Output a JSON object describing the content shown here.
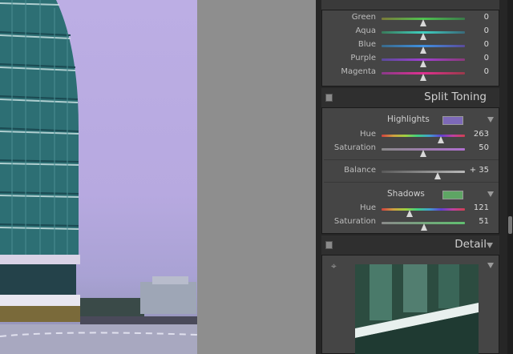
{
  "hsl_tail": [
    {
      "label": "Green",
      "value": "0",
      "thumb": 0.5,
      "gradient": "linear-gradient(90deg,#7a7a3a,#4fc24f,#3a7a4a)"
    },
    {
      "label": "Aqua",
      "value": "0",
      "thumb": 0.5,
      "gradient": "linear-gradient(90deg,#3a7a5a,#3fd0c0,#3a6a7a)"
    },
    {
      "label": "Blue",
      "value": "0",
      "thumb": 0.5,
      "gradient": "linear-gradient(90deg,#3a6a8a,#3f90e0,#5a4a9a)"
    },
    {
      "label": "Purple",
      "value": "0",
      "thumb": 0.5,
      "gradient": "linear-gradient(90deg,#5a4a9a,#a040d0,#8a3a7a)"
    },
    {
      "label": "Magenta",
      "value": "0",
      "thumb": 0.5,
      "gradient": "linear-gradient(90deg,#8a3a8a,#e03090,#9a3a4a)"
    }
  ],
  "split_toning": {
    "title": "Split Toning",
    "highlights": {
      "label": "Highlights",
      "swatch": "#7d69b8",
      "hue": {
        "label": "Hue",
        "value": "263",
        "thumb": 0.71
      },
      "saturation": {
        "label": "Saturation",
        "value": "50",
        "thumb": 0.5
      }
    },
    "balance": {
      "label": "Balance",
      "value": "+ 35",
      "thumb": 0.67
    },
    "shadows": {
      "label": "Shadows",
      "swatch": "#5ea564",
      "hue": {
        "label": "Hue",
        "value": "121",
        "thumb": 0.34
      },
      "saturation": {
        "label": "Saturation",
        "value": "51",
        "thumb": 0.51
      }
    }
  },
  "detail": {
    "title": "Detail"
  },
  "colors": {
    "hue_gradient": "linear-gradient(90deg,#d04040,#d0a040,#a0d040,#40d080,#40a0d0,#6040d0,#c040a0,#d04050)",
    "sat_gradient_high": "linear-gradient(90deg,#8a8a8a,#b070d0)",
    "sat_gradient_shadow": "linear-gradient(90deg,#8a8a8a,#60c070)",
    "balance_gradient": "linear-gradient(90deg,#5a5a5a,#b8b8b8)"
  }
}
